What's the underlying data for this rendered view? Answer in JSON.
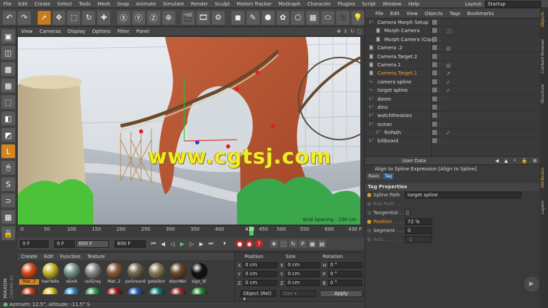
{
  "menubar": {
    "items": [
      "File",
      "Edit",
      "Create",
      "Select",
      "Tools",
      "Mesh",
      "Snap",
      "Animate",
      "Simulate",
      "Render",
      "Sculpt",
      "Motion Tracker",
      "MoGraph",
      "Character",
      "Plugins",
      "Script",
      "Window",
      "Help"
    ],
    "layout_label": "Layout:",
    "layout_value": "Startup"
  },
  "viewport": {
    "menu": [
      "View",
      "Cameras",
      "Display",
      "Options",
      "Filter",
      "Panel"
    ],
    "grid_spacing": "Grid Spacing : 100 cm",
    "watermark": "www.cgtsj.com"
  },
  "timeline": {
    "ticks": [
      "0",
      "50",
      "100",
      "150",
      "200",
      "250",
      "300",
      "350",
      "400",
      "450",
      "500",
      "550",
      "600"
    ],
    "current_frame": "430",
    "playhead_fraction": 0.7167,
    "end_label": "430 F"
  },
  "transport": {
    "start_field": "0 F",
    "min_field": "0 F",
    "max_field": "600 F",
    "end_field": "600 F"
  },
  "materials": {
    "menu": [
      "Create",
      "Edit",
      "Function",
      "Texture"
    ],
    "items": [
      {
        "label": "Mat..3",
        "color": "#d84a1a",
        "selected": true
      },
      {
        "label": "hairYello",
        "color": "#c9b42c",
        "selected": false
      },
      {
        "label": "skinA",
        "color": "#7a9a88",
        "selected": false
      },
      {
        "label": "railGray",
        "color": "#8a8a8a",
        "selected": false
      },
      {
        "label": "Mat..2",
        "color": "#8a5a3a",
        "selected": false
      },
      {
        "label": "pxGround",
        "color": "#7a6a50",
        "selected": false
      },
      {
        "label": "gateStor",
        "color": "#8a7a5a",
        "selected": false
      },
      {
        "label": "doorWor",
        "color": "#6a4a2a",
        "selected": false
      },
      {
        "label": "sign_bl",
        "color": "#111111",
        "selected": false
      }
    ],
    "row2_colors": [
      "#c8441a",
      "#d8c030",
      "#3a8ac0",
      "#3a9a5a",
      "#9a2020",
      "#2a5ab0",
      "#1a7a7a",
      "#a03030",
      "#2a8a3a"
    ]
  },
  "coordinates": {
    "headers": {
      "position": "Position",
      "size": "Size",
      "rotation": "Rotation"
    },
    "rows": [
      {
        "axis": "X",
        "pos": "0 cm",
        "size_axis": "X",
        "size": "0 cm",
        "rot_axis": "H",
        "rot": "0 °"
      },
      {
        "axis": "Y",
        "pos": "0 cm",
        "size_axis": "Y",
        "size": "0 cm",
        "rot_axis": "P",
        "rot": "0 °"
      },
      {
        "axis": "Z",
        "pos": "0 cm",
        "size_axis": "Z",
        "size": "0 cm",
        "rot_axis": "B",
        "rot": "0 °"
      }
    ],
    "mode": "Object (Rel) ▾",
    "size_mode": "Size ▾",
    "apply": "Apply"
  },
  "status": {
    "text": "Azimuth: 12.5°, Altitude: -11.5°  S"
  },
  "logo": {
    "line1": "MAXON",
    "line2": "CINEMA 4D"
  },
  "object_manager": {
    "menu": [
      "File",
      "Edit",
      "View",
      "Objects",
      "Tags",
      "Bookmarks"
    ],
    "rows": [
      {
        "name": "Camera Morph Setup",
        "indent": 0,
        "selected": false,
        "tag": ""
      },
      {
        "name": "Morph Camera",
        "indent": 1,
        "selected": false,
        "tag": "🎥"
      },
      {
        "name": "Morph Camera (Copy)",
        "indent": 1,
        "selected": false,
        "tag": ""
      },
      {
        "name": "Camera .2",
        "indent": 0,
        "selected": false,
        "tag": "◎"
      },
      {
        "name": "Camera.Target.2",
        "indent": 0,
        "selected": false,
        "tag": ""
      },
      {
        "name": "Camera.1",
        "indent": 0,
        "selected": false,
        "tag": "◎"
      },
      {
        "name": "Camera.Target.1",
        "indent": 0,
        "selected": true,
        "tag": "↗"
      },
      {
        "name": "camera spline",
        "indent": 0,
        "selected": false,
        "tag": "✓"
      },
      {
        "name": "target spline",
        "indent": 0,
        "selected": false,
        "tag": "✓"
      },
      {
        "name": "doom",
        "indent": 0,
        "selected": false,
        "tag": ""
      },
      {
        "name": "dino",
        "indent": 0,
        "selected": false,
        "tag": ""
      },
      {
        "name": "watchtheskies",
        "indent": 0,
        "selected": false,
        "tag": ""
      },
      {
        "name": "ocean",
        "indent": 0,
        "selected": false,
        "tag": ""
      },
      {
        "name": "finPath",
        "indent": 1,
        "selected": false,
        "tag": "✓"
      },
      {
        "name": "billboard",
        "indent": 0,
        "selected": false,
        "tag": ""
      }
    ]
  },
  "right_tabs": [
    "Objects",
    "Content Browser",
    "Structure",
    "Attributes",
    "Layers"
  ],
  "attribute_manager": {
    "top_label": "User Data",
    "title": "Align to Spline Expression [Align to Spline]",
    "tabs": [
      "Basic",
      "Tag"
    ],
    "active_tab": "Tag",
    "section": "Tag Properties",
    "rows": [
      {
        "label": "Spline Path",
        "value": "target spline",
        "on": true,
        "dim": false
      },
      {
        "label": "Rail Path . .",
        "value": "",
        "on": false,
        "dim": true
      },
      {
        "label": "Tangential . .",
        "value": "",
        "on": false,
        "dim": false
      },
      {
        "label": "Position . . . .",
        "value": "72 %",
        "on": true,
        "dim": false
      },
      {
        "label": "Segment . . .",
        "value": "0",
        "on": false,
        "dim": false
      },
      {
        "label": "Axis . . . . . .",
        "value": "-Z",
        "on": false,
        "dim": true
      }
    ]
  }
}
